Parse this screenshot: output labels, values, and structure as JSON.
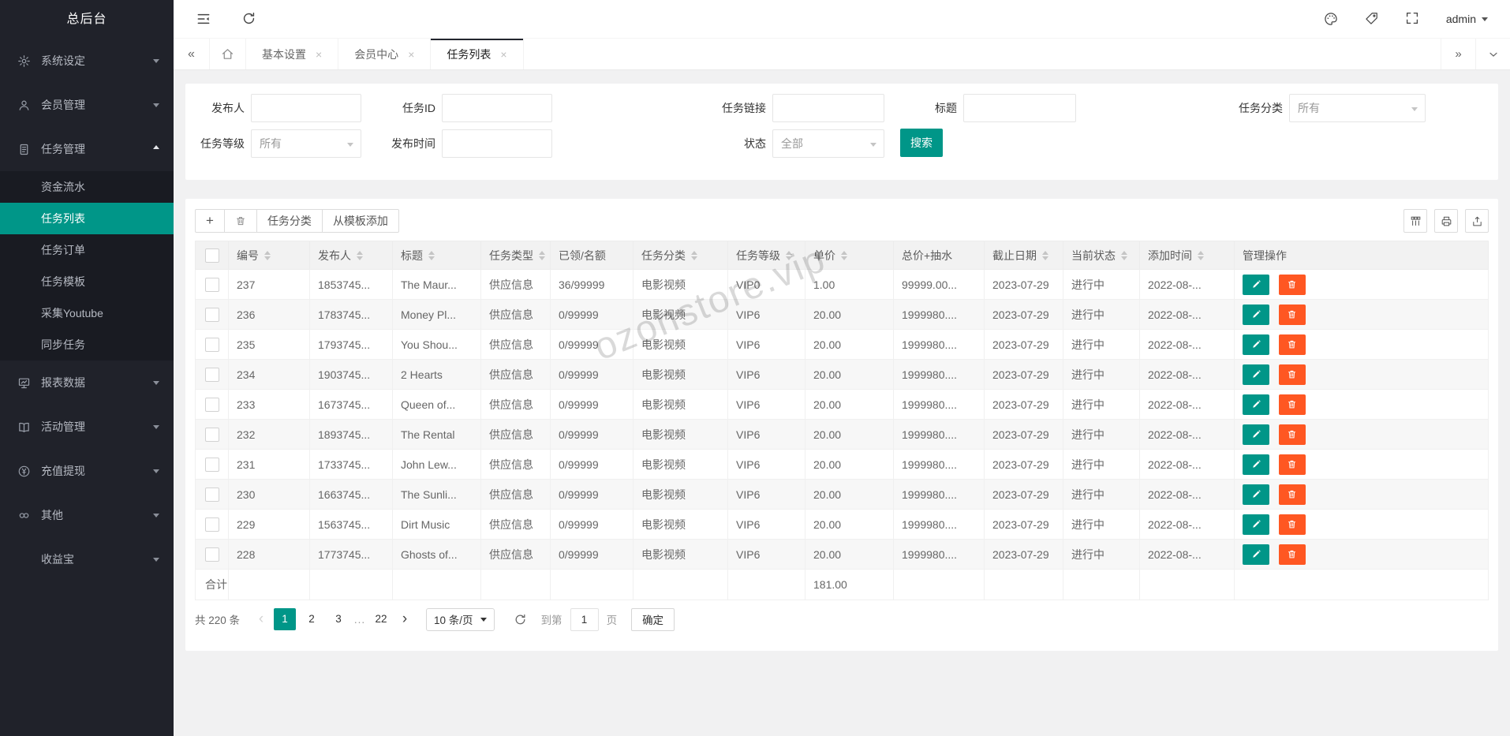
{
  "app": {
    "accent_color": "#009688",
    "danger_color": "#ff5722",
    "sidebar_bg": "#20222a"
  },
  "sidebar": {
    "title": "总后台",
    "items": [
      {
        "label": "系统设定",
        "icon": "gear-icon",
        "state": "collapsed"
      },
      {
        "label": "会员管理",
        "icon": "user-icon",
        "state": "collapsed"
      },
      {
        "label": "任务管理",
        "icon": "document-icon",
        "state": "expanded"
      },
      {
        "label": "报表数据",
        "icon": "chart-icon",
        "state": "collapsed"
      },
      {
        "label": "活动管理",
        "icon": "book-icon",
        "state": "collapsed"
      },
      {
        "label": "充值提现",
        "icon": "yen-icon",
        "state": "collapsed"
      },
      {
        "label": "其他",
        "icon": "link-icon",
        "state": "collapsed"
      },
      {
        "label": "收益宝",
        "icon": "",
        "state": "collapsed"
      }
    ],
    "task_submenu": {
      "items": [
        "资金流水",
        "任务列表",
        "任务订单",
        "任务模板",
        "采集Youtube",
        "同步任务"
      ],
      "active": "任务列表"
    }
  },
  "topbar": {
    "username": "admin"
  },
  "tabs": [
    {
      "label": "基本设置",
      "active": false
    },
    {
      "label": "会员中心",
      "active": false
    },
    {
      "label": "任务列表",
      "active": true
    }
  ],
  "search_form": {
    "publisher_label": "发布人",
    "task_id_label": "任务ID",
    "task_link_label": "任务链接",
    "title_label": "标题",
    "category_label": "任务分类",
    "category_value": "所有",
    "level_label": "任务等级",
    "level_value": "所有",
    "publish_time_label": "发布时间",
    "status_label": "状态",
    "status_value": "全部",
    "search_button": "搜索"
  },
  "toolbar": {
    "add_button": "+",
    "category_button": "任务分类",
    "template_button": "从模板添加"
  },
  "table": {
    "columns": [
      {
        "label": "编号",
        "sortable": true
      },
      {
        "label": "发布人",
        "sortable": true
      },
      {
        "label": "标题",
        "sortable": true
      },
      {
        "label": "任务类型",
        "sortable": true
      },
      {
        "label": "已领/名额",
        "sortable": false
      },
      {
        "label": "任务分类",
        "sortable": true
      },
      {
        "label": "任务等级",
        "sortable": true
      },
      {
        "label": "单价",
        "sortable": true
      },
      {
        "label": "总价+抽水",
        "sortable": false
      },
      {
        "label": "截止日期",
        "sortable": true
      },
      {
        "label": "当前状态",
        "sortable": true
      },
      {
        "label": "添加时间",
        "sortable": true
      },
      {
        "label": "管理操作",
        "sortable": false
      }
    ],
    "rows": [
      {
        "id": "237",
        "publisher": "1853745...",
        "title": "The Maur...",
        "type": "供应信息",
        "quota": "36/99999",
        "category": "电影视频",
        "level": "VIP0",
        "price": "1.00",
        "total": "99999.00...",
        "deadline": "2023-07-29",
        "status": "进行中",
        "added": "2022-08-..."
      },
      {
        "id": "236",
        "publisher": "1783745...",
        "title": "Money Pl...",
        "type": "供应信息",
        "quota": "0/99999",
        "category": "电影视频",
        "level": "VIP6",
        "price": "20.00",
        "total": "1999980....",
        "deadline": "2023-07-29",
        "status": "进行中",
        "added": "2022-08-..."
      },
      {
        "id": "235",
        "publisher": "1793745...",
        "title": "You Shou...",
        "type": "供应信息",
        "quota": "0/99999",
        "category": "电影视频",
        "level": "VIP6",
        "price": "20.00",
        "total": "1999980....",
        "deadline": "2023-07-29",
        "status": "进行中",
        "added": "2022-08-..."
      },
      {
        "id": "234",
        "publisher": "1903745...",
        "title": "2 Hearts",
        "type": "供应信息",
        "quota": "0/99999",
        "category": "电影视频",
        "level": "VIP6",
        "price": "20.00",
        "total": "1999980....",
        "deadline": "2023-07-29",
        "status": "进行中",
        "added": "2022-08-..."
      },
      {
        "id": "233",
        "publisher": "1673745...",
        "title": "Queen of...",
        "type": "供应信息",
        "quota": "0/99999",
        "category": "电影视频",
        "level": "VIP6",
        "price": "20.00",
        "total": "1999980....",
        "deadline": "2023-07-29",
        "status": "进行中",
        "added": "2022-08-..."
      },
      {
        "id": "232",
        "publisher": "1893745...",
        "title": "The Rental",
        "type": "供应信息",
        "quota": "0/99999",
        "category": "电影视频",
        "level": "VIP6",
        "price": "20.00",
        "total": "1999980....",
        "deadline": "2023-07-29",
        "status": "进行中",
        "added": "2022-08-..."
      },
      {
        "id": "231",
        "publisher": "1733745...",
        "title": "John Lew...",
        "type": "供应信息",
        "quota": "0/99999",
        "category": "电影视频",
        "level": "VIP6",
        "price": "20.00",
        "total": "1999980....",
        "deadline": "2023-07-29",
        "status": "进行中",
        "added": "2022-08-..."
      },
      {
        "id": "230",
        "publisher": "1663745...",
        "title": "The Sunli...",
        "type": "供应信息",
        "quota": "0/99999",
        "category": "电影视频",
        "level": "VIP6",
        "price": "20.00",
        "total": "1999980....",
        "deadline": "2023-07-29",
        "status": "进行中",
        "added": "2022-08-..."
      },
      {
        "id": "229",
        "publisher": "1563745...",
        "title": "Dirt Music",
        "type": "供应信息",
        "quota": "0/99999",
        "category": "电影视频",
        "level": "VIP6",
        "price": "20.00",
        "total": "1999980....",
        "deadline": "2023-07-29",
        "status": "进行中",
        "added": "2022-08-..."
      },
      {
        "id": "228",
        "publisher": "1773745...",
        "title": "Ghosts of...",
        "type": "供应信息",
        "quota": "0/99999",
        "category": "电影视频",
        "level": "VIP6",
        "price": "20.00",
        "total": "1999980....",
        "deadline": "2023-07-29",
        "status": "进行中",
        "added": "2022-08-..."
      }
    ],
    "total_label": "合计",
    "total_price": "181.00"
  },
  "pagination": {
    "total_text": "共 220 条",
    "prev": "‹",
    "next": "›",
    "pages": [
      "1",
      "2",
      "3",
      "...",
      "22"
    ],
    "active_page": "1",
    "page_size": "10 条/页",
    "goto_label": "到第",
    "goto_value": "1",
    "page_unit": "页",
    "confirm_button": "确定"
  },
  "watermark": "ozonstore.vip"
}
